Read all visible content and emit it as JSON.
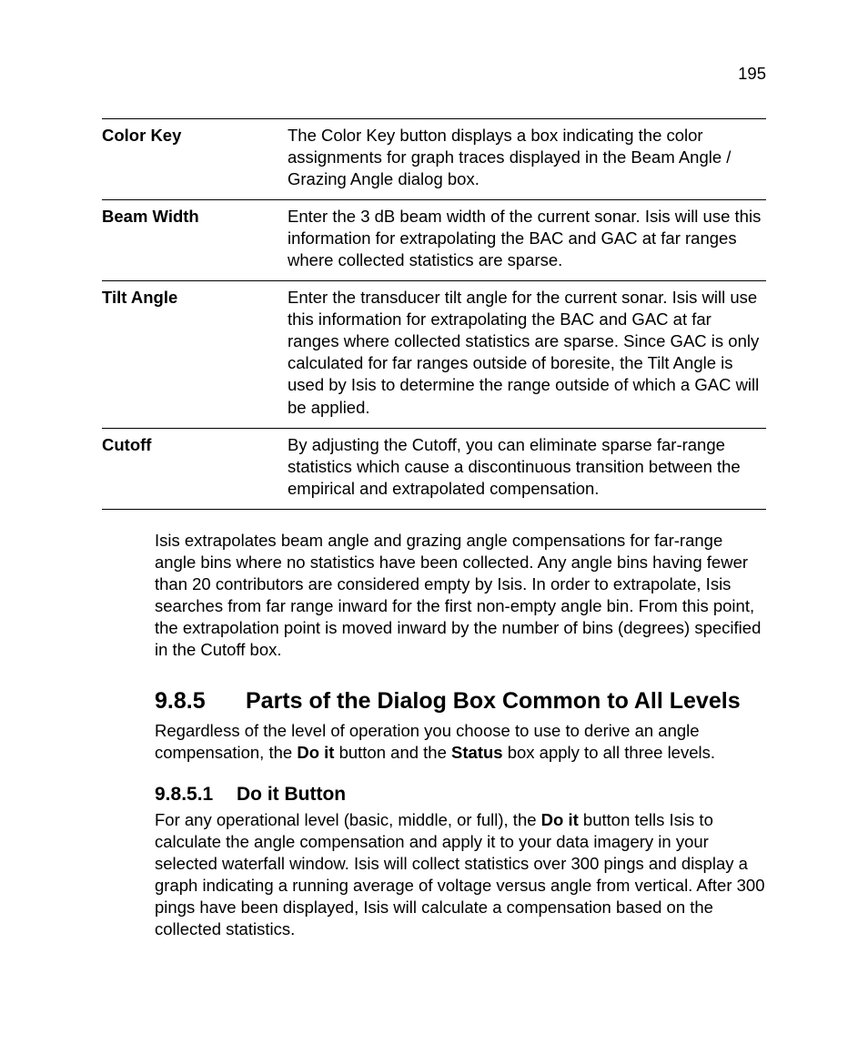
{
  "page_number": "195",
  "table": {
    "rows": [
      {
        "term": "Color Key",
        "desc": "The Color Key button displays a box indicating the color assignments for graph traces displayed in the Beam Angle / Grazing Angle dialog box."
      },
      {
        "term": "Beam Width",
        "desc": "Enter the 3 dB beam width of the current sonar. Isis will use this information for extrapolating the BAC and GAC at far ranges where collected statistics are sparse."
      },
      {
        "term": "Tilt Angle",
        "desc": "Enter the transducer tilt angle for the current sonar. Isis will use this information for extrapolating the BAC and GAC at far ranges where collected statistics are sparse. Since GAC is only calculated for far ranges outside of boresite, the Tilt Angle is used by Isis to determine the range outside of which a GAC will be applied."
      },
      {
        "term": "Cutoff",
        "desc": "By adjusting the Cutoff, you can eliminate sparse far-range statistics which cause a discontinuous transition between the empirical and extrapolated compensation."
      }
    ]
  },
  "extrapolate_text": "Isis extrapolates beam angle and grazing angle compensations for far-range angle bins where no statistics have been collected. Any angle bins having fewer than 20 contributors are considered empty by Isis. In order to extrapolate, Isis searches from far range inward for the first non-empty angle bin. From this point, the extrapolation point is moved inward by the number of bins (degrees) specified in the Cutoff box.",
  "section": {
    "num": "9.8.5",
    "title": "Parts of the Dialog Box Common to All Levels"
  },
  "section_intro": {
    "pre": "Regardless of the level of operation you choose to use to derive an angle compensation, the ",
    "b1": "Do it",
    "mid": " button and the ",
    "b2": "Status",
    "post": " box apply to all three levels."
  },
  "subsection": {
    "num": "9.8.5.1",
    "title": "Do it Button"
  },
  "doit": {
    "pre": "For any operational level (basic, middle, or full), the ",
    "b1": "Do it",
    "post": " button tells Isis to calculate the angle compensation and apply it to your data imagery in your selected waterfall window. Isis will collect statistics over 300 pings and display a graph indicating a running average of voltage versus angle from vertical. After 300 pings have been displayed, Isis will calculate a compensation based on the collected statistics."
  }
}
